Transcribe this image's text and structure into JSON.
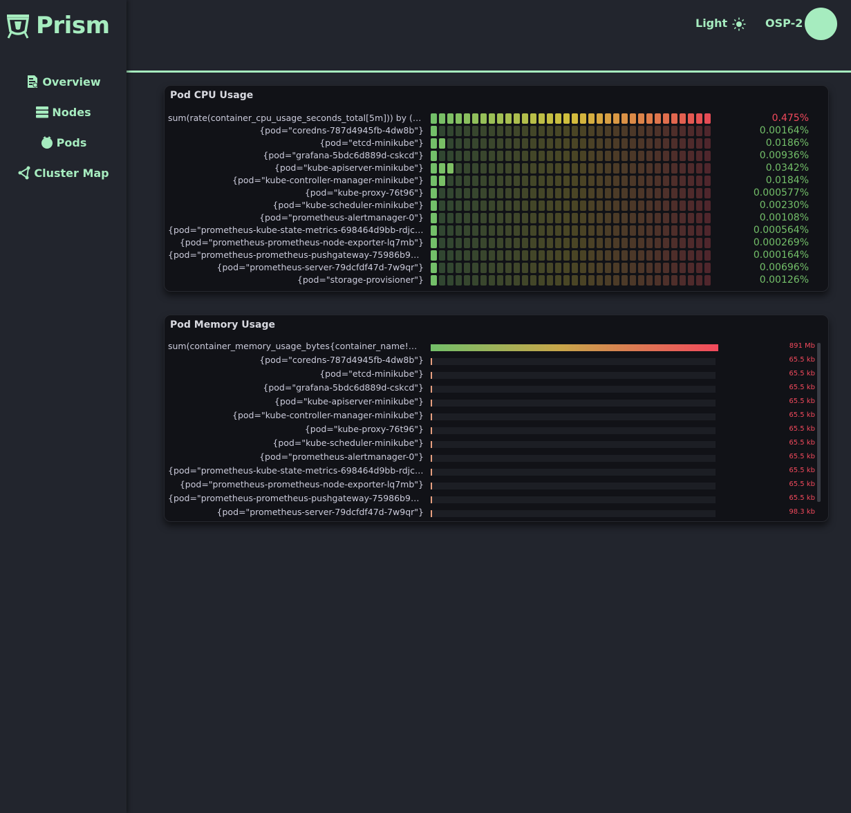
{
  "app": {
    "name": "Prism"
  },
  "nav": [
    {
      "label": "Overview",
      "icon": "document-chart-icon"
    },
    {
      "label": "Nodes",
      "icon": "server-icon"
    },
    {
      "label": "Pods",
      "icon": "pod-icon"
    },
    {
      "label": "Cluster Map",
      "icon": "graph-icon"
    }
  ],
  "header": {
    "theme_label": "Light",
    "user": "OSP-2"
  },
  "colors": {
    "accent": "#a6ecbf",
    "low": "#73bf69",
    "mid": "#c8a64a",
    "high": "#f2495c"
  },
  "cpu": {
    "title": "Pod CPU Usage",
    "rows": [
      {
        "label": "sum(rate(container_cpu_usage_seconds_total[5m])) by (pod)",
        "value": "0.475%",
        "level": 1.0,
        "high": true
      },
      {
        "label": "{pod=\"coredns-787d4945fb-4dw8b\"}",
        "value": "0.00164%",
        "level": 0.0035
      },
      {
        "label": "{pod=\"etcd-minikube\"}",
        "value": "0.0186%",
        "level": 0.039
      },
      {
        "label": "{pod=\"grafana-5bdc6d889d-cskcd\"}",
        "value": "0.00936%",
        "level": 0.02
      },
      {
        "label": "{pod=\"kube-apiserver-minikube\"}",
        "value": "0.0342%",
        "level": 0.072
      },
      {
        "label": "{pod=\"kube-controller-manager-minikube\"}",
        "value": "0.0184%",
        "level": 0.039
      },
      {
        "label": "{pod=\"kube-proxy-76t96\"}",
        "value": "0.000577%",
        "level": 0.0012
      },
      {
        "label": "{pod=\"kube-scheduler-minikube\"}",
        "value": "0.00230%",
        "level": 0.0048
      },
      {
        "label": "{pod=\"prometheus-alertmanager-0\"}",
        "value": "0.00108%",
        "level": 0.0023
      },
      {
        "label": "{pod=\"prometheus-kube-state-metrics-698464d9bb-rdjcs\"}",
        "value": "0.000564%",
        "level": 0.0012
      },
      {
        "label": "{pod=\"prometheus-prometheus-node-exporter-lq7mb\"}",
        "value": "0.000269%",
        "level": 0.0006
      },
      {
        "label": "{pod=\"prometheus-prometheus-pushgateway-75986b9c9f-...",
        "value": "0.000164%",
        "level": 0.0003
      },
      {
        "label": "{pod=\"prometheus-server-79dcfdf47d-7w9qr\"}",
        "value": "0.00696%",
        "level": 0.015
      },
      {
        "label": "{pod=\"storage-provisioner\"}",
        "value": "0.00126%",
        "level": 0.0027
      }
    ]
  },
  "memory": {
    "title": "Pod Memory Usage",
    "rows": [
      {
        "label": "sum(container_memory_usage_bytes{container_name!=\"POD...",
        "value": "891 Mb",
        "level": 1.0
      },
      {
        "label": "{pod=\"coredns-787d4945fb-4dw8b\"}",
        "value": "65.5 kb",
        "level": 0.0001
      },
      {
        "label": "{pod=\"etcd-minikube\"}",
        "value": "65.5 kb",
        "level": 0.0001
      },
      {
        "label": "{pod=\"grafana-5bdc6d889d-cskcd\"}",
        "value": "65.5 kb",
        "level": 0.0001
      },
      {
        "label": "{pod=\"kube-apiserver-minikube\"}",
        "value": "65.5 kb",
        "level": 0.0001
      },
      {
        "label": "{pod=\"kube-controller-manager-minikube\"}",
        "value": "65.5 kb",
        "level": 0.0001
      },
      {
        "label": "{pod=\"kube-proxy-76t96\"}",
        "value": "65.5 kb",
        "level": 0.0001
      },
      {
        "label": "{pod=\"kube-scheduler-minikube\"}",
        "value": "65.5 kb",
        "level": 0.0001
      },
      {
        "label": "{pod=\"prometheus-alertmanager-0\"}",
        "value": "65.5 kb",
        "level": 0.0001
      },
      {
        "label": "{pod=\"prometheus-kube-state-metrics-698464d9bb-rdjcs\"}",
        "value": "65.5 kb",
        "level": 0.0001
      },
      {
        "label": "{pod=\"prometheus-prometheus-node-exporter-lq7mb\"}",
        "value": "65.5 kb",
        "level": 0.0001
      },
      {
        "label": "{pod=\"prometheus-prometheus-pushgateway-75986b9c9f-...",
        "value": "65.5 kb",
        "level": 0.0001
      },
      {
        "label": "{pod=\"prometheus-server-79dcfdf47d-7w9qr\"}",
        "value": "98.3 kb",
        "level": 0.0001
      }
    ]
  }
}
